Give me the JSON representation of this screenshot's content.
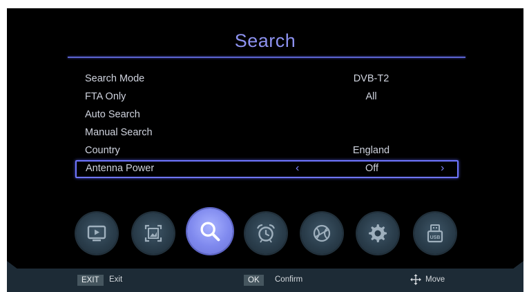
{
  "title": "Search",
  "menu": [
    {
      "label": "Search Mode",
      "value": "DVB-T2"
    },
    {
      "label": "FTA Only",
      "value": "All"
    },
    {
      "label": "Auto Search",
      "value": ""
    },
    {
      "label": "Manual Search",
      "value": ""
    },
    {
      "label": "Country",
      "value": "England"
    },
    {
      "label": "Antenna Power",
      "value": "Off",
      "selected": true
    }
  ],
  "arrows": {
    "left": "‹",
    "right": "›"
  },
  "icons": [
    {
      "name": "tv-icon",
      "active": false
    },
    {
      "name": "picture-icon",
      "active": false
    },
    {
      "name": "search-icon",
      "active": true
    },
    {
      "name": "alarm-clock-icon",
      "active": false
    },
    {
      "name": "globe-icon",
      "active": false
    },
    {
      "name": "gear-icon",
      "active": false
    },
    {
      "name": "usb-icon",
      "active": false
    }
  ],
  "usb_text": "USB",
  "footer": {
    "exit_key": "EXIT",
    "exit_label": "Exit",
    "ok_key": "OK",
    "ok_label": "Confirm",
    "move_label": "Move"
  },
  "colors": {
    "accent": "#7d84ff",
    "title": "#8d92f0",
    "footer": "#1d2b36"
  }
}
